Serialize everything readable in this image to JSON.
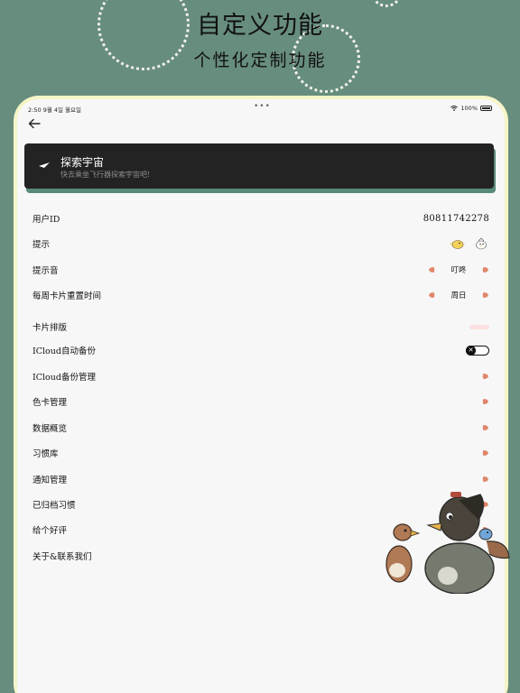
{
  "promo": {
    "title": "自定义功能",
    "subtitle": "个性化定制功能"
  },
  "status_bar": {
    "time": "2:50",
    "date": "9월 4일 월요일",
    "battery": "100%"
  },
  "banner": {
    "title": "探索宇宙",
    "subtitle": "快去乘坐飞行器探索宇宙吧!"
  },
  "settings": {
    "user_id_label": "用户ID",
    "user_id_value": "80811742278",
    "hint_label": "提示",
    "hint_sound_label": "提示音",
    "hint_sound_value": "叮咚",
    "weekly_reset_label": "每周卡片重置时间",
    "weekly_reset_value": "周日",
    "card_layout_label": "卡片排版",
    "icloud_backup_label": "ICloud自动备份",
    "icloud_manage_label": "ICloud备份管理",
    "color_card_label": "色卡管理",
    "data_overview_label": "数据概览",
    "habit_library_label": "习惯库",
    "notification_label": "通知管理",
    "archived_label": "已归档习惯",
    "review_label": "给个好评",
    "about_label": "关于&联系我们"
  },
  "colors": {
    "background": "#678d7e",
    "device_frame": "#f5f5c8",
    "banner": "#232323",
    "arrow": "#e0866a"
  },
  "icons": {
    "back": "back-arrow-icon",
    "plane": "paper-plane-icon",
    "chevron": "chevron-right-icon",
    "left_chevron": "chevron-left-icon"
  }
}
